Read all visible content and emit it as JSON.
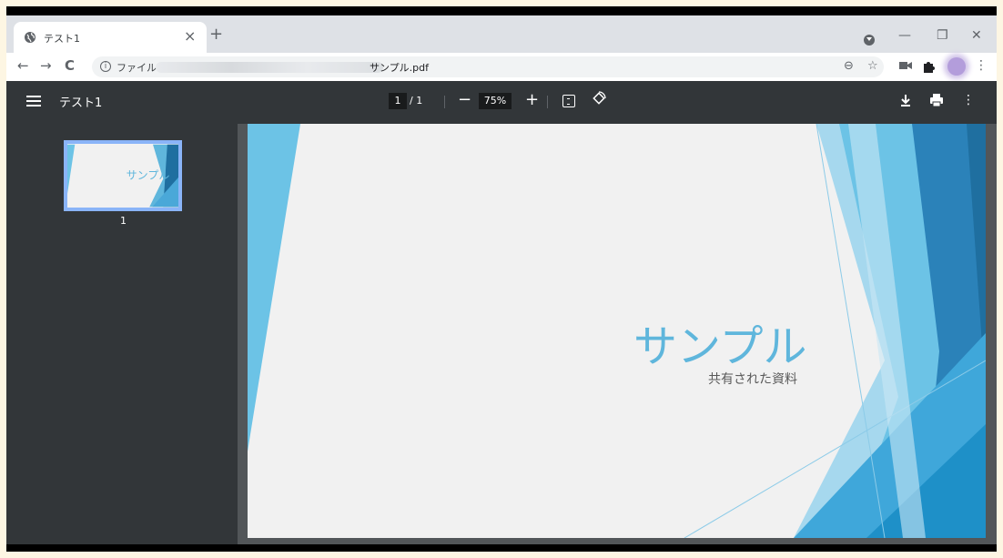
{
  "tab": {
    "title": "テスト1",
    "close": "×",
    "new": "+"
  },
  "window": {
    "minimize": "—",
    "restore": "❐",
    "close": "✕"
  },
  "toolbar": {
    "back": "←",
    "forward": "→",
    "reload": "C",
    "info": "i",
    "scheme": "ファイル",
    "url_filename": "サンプル.pdf",
    "zoom_icon": "⊖",
    "star": "☆",
    "menu": "⋮"
  },
  "pdf": {
    "title": "テスト1",
    "current_page": "1",
    "total_pages": "/ 1",
    "zoom_out": "−",
    "zoom": "75%",
    "zoom_in": "+",
    "download": "⤓",
    "print": "⎙",
    "more": "⋮",
    "thumb_number": "1"
  },
  "slide": {
    "title": "サンプル",
    "subtitle": "共有された資料",
    "colors": {
      "accent": "#5fb6dc",
      "dark": "#1f6fa0",
      "light": "#a6d8ee"
    }
  },
  "thumbnail": {
    "title": "サンプル"
  }
}
